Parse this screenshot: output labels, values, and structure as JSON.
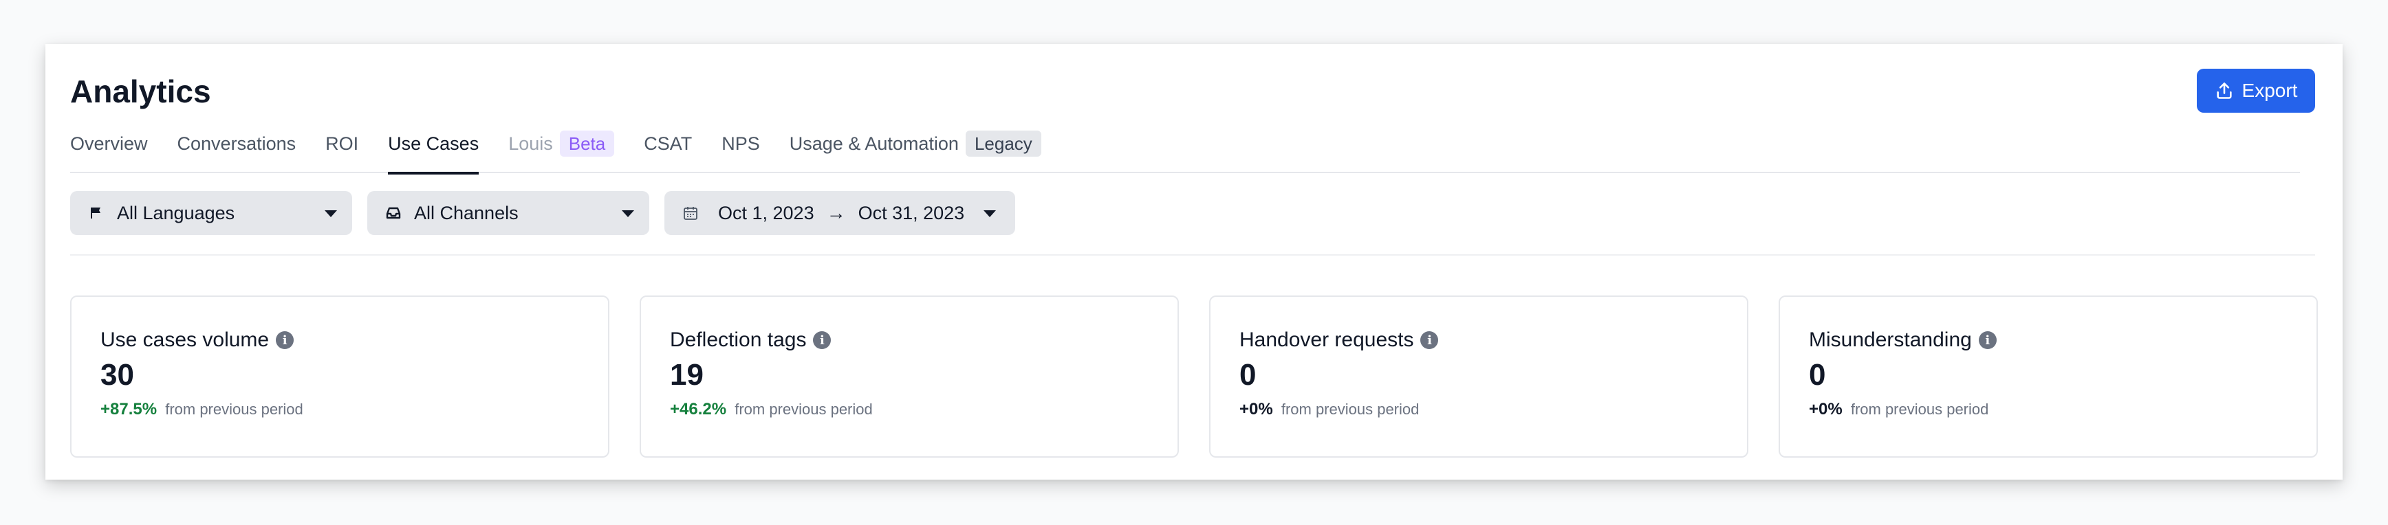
{
  "header": {
    "title": "Analytics",
    "export_label": "Export"
  },
  "tabs": [
    {
      "label": "Overview",
      "active": false
    },
    {
      "label": "Conversations",
      "active": false
    },
    {
      "label": "ROI",
      "active": false
    },
    {
      "label": "Use Cases",
      "active": true
    },
    {
      "label": "Louis",
      "badge": "Beta",
      "muted": true
    },
    {
      "label": "CSAT",
      "active": false
    },
    {
      "label": "NPS",
      "active": false
    },
    {
      "label": "Usage & Automation",
      "badge": "Legacy"
    }
  ],
  "filters": {
    "languages": "All Languages",
    "channels": "All Channels",
    "date_from": "Oct 1, 2023",
    "date_to": "Oct 31, 2023",
    "arrow": "→"
  },
  "cards": [
    {
      "title": "Use cases volume",
      "value": "30",
      "change": "+87.5%",
      "change_kind": "positive",
      "suffix": "from previous period"
    },
    {
      "title": "Deflection tags",
      "value": "19",
      "change": "+46.2%",
      "change_kind": "positive",
      "suffix": "from previous period"
    },
    {
      "title": "Handover requests",
      "value": "0",
      "change": "+0%",
      "change_kind": "neutral",
      "suffix": "from previous period"
    },
    {
      "title": "Misunderstanding",
      "value": "0",
      "change": "+0%",
      "change_kind": "neutral",
      "suffix": "from previous period"
    }
  ],
  "colors": {
    "accent": "#2563eb",
    "positive": "#15803d",
    "beta": "#8b5cf6"
  },
  "icons": {
    "export": "upload-icon",
    "languages": "flag-icon",
    "channels": "inbox-icon",
    "date": "calendar-icon",
    "info": "info-icon"
  }
}
